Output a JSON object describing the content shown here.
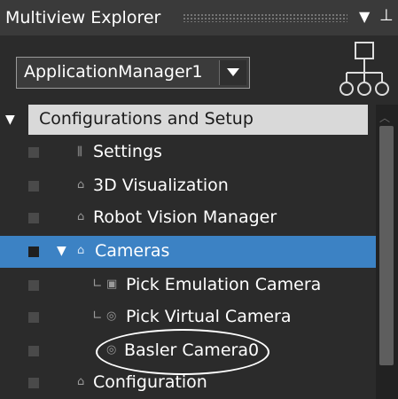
{
  "window": {
    "title": "Multiview Explorer"
  },
  "toolbar": {
    "selected_app": "ApplicationManager1"
  },
  "tree": {
    "header": "Configurations and Setup",
    "items": [
      {
        "label": "Settings",
        "icon": "sliders-icon"
      },
      {
        "label": "3D Visualization",
        "icon": "folder-icon"
      },
      {
        "label": "Robot Vision Manager",
        "icon": "folder-icon"
      },
      {
        "label": "Cameras",
        "icon": "folder-icon",
        "expanded": true,
        "selected": true
      },
      {
        "label": "Pick Emulation Camera",
        "icon": "camera-image-icon"
      },
      {
        "label": "Pick Virtual Camera",
        "icon": "virtual-camera-icon"
      },
      {
        "label": "Basler Camera0",
        "icon": "virtual-camera-icon",
        "highlighted": true
      },
      {
        "label": "Configuration",
        "icon": "folder-icon"
      }
    ]
  },
  "colors": {
    "selected_row": "#3c82c4",
    "header_row": "#d9d9d9",
    "panel_bg": "#2b2b2b"
  }
}
